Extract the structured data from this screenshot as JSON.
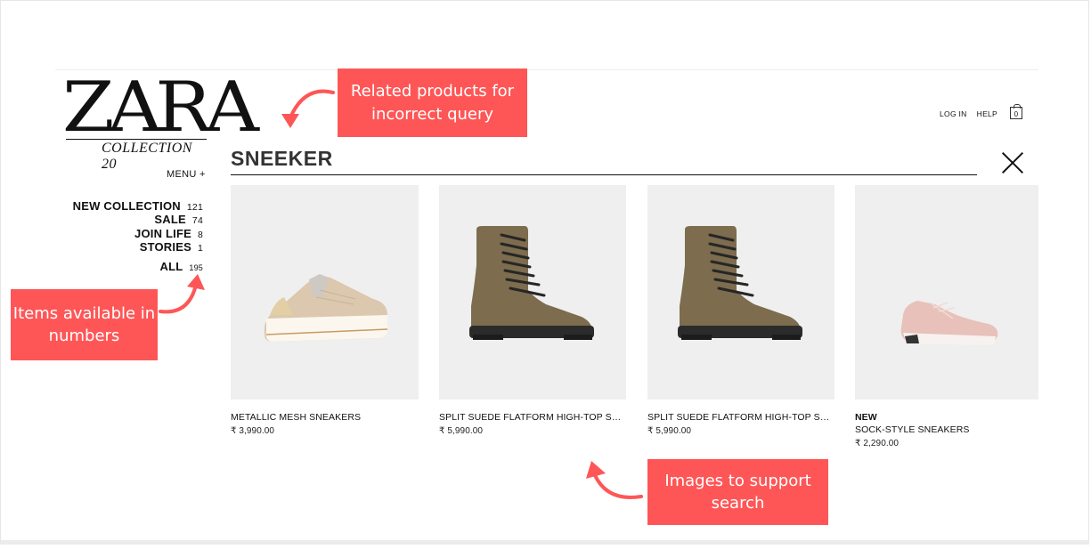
{
  "logo": {
    "word": "ZARA",
    "sub": "COLLECTION 20"
  },
  "menu_label": "MENU +",
  "categories": [
    {
      "label": "NEW COLLECTION",
      "count": "121"
    },
    {
      "label": "SALE",
      "count": "74"
    },
    {
      "label": "JOIN LIFE",
      "count": "8"
    },
    {
      "label": "STORIES",
      "count": "1"
    },
    {
      "label": "ALL",
      "count": "195"
    }
  ],
  "header": {
    "login": "LOG IN",
    "help": "HELP",
    "bag_count": "0"
  },
  "search": {
    "query": "SNEEKER"
  },
  "products": [
    {
      "tag": "",
      "name": "METALLIC MESH SNEAKERS",
      "price": "₹ 3,990.00",
      "icon": "beige-sneaker"
    },
    {
      "tag": "",
      "name": "SPLIT SUEDE FLATFORM HIGH-TOP SNE...",
      "price": "₹ 5,990.00",
      "icon": "khaki-boot"
    },
    {
      "tag": "",
      "name": "SPLIT SUEDE FLATFORM HIGH-TOP SNE...",
      "price": "₹ 5,990.00",
      "icon": "khaki-boot"
    },
    {
      "tag": "NEW",
      "name": "SOCK-STYLE SNEAKERS",
      "price": "₹ 2,290.00",
      "icon": "pink-sneaker"
    }
  ],
  "annotations": {
    "related": "Related products for incorrect query",
    "items": "Items available in numbers",
    "images": "Images to support search"
  },
  "colors": {
    "annotation": "#fe5656",
    "product_bg": "#efefef"
  }
}
